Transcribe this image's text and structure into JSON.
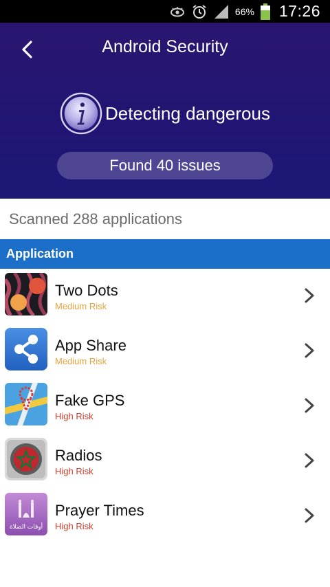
{
  "status_bar": {
    "battery_percent": "66%",
    "time": "17:26",
    "icons": [
      "eye-icon",
      "alarm-icon",
      "signal-icon",
      "battery-icon"
    ]
  },
  "header": {
    "title": "Android Security",
    "detect_text": "Detecting dangerous",
    "found_text": "Found 40 issues"
  },
  "scan": {
    "scanned_text": "Scanned 288 applications"
  },
  "section": {
    "label": "Application"
  },
  "apps": [
    {
      "name": "Two Dots",
      "risk": "Medium Risk",
      "icon": "two-dots-icon"
    },
    {
      "name": "App Share",
      "risk": "Medium Risk",
      "icon": "share-icon"
    },
    {
      "name": "Fake GPS",
      "risk": "High Risk",
      "icon": "map-pin-icon"
    },
    {
      "name": "Radios",
      "risk": "High Risk",
      "icon": "radio-flag-icon"
    },
    {
      "name": "Prayer Times",
      "risk": "High Risk",
      "icon": "mosque-icon",
      "icon_text": "أوقات الصلاة"
    }
  ],
  "colors": {
    "header_bg": "#201573",
    "pill_bg": "#4e4593",
    "section_bg": "#1b6fc9",
    "medium_risk": "#e8a23a",
    "high_risk": "#d23b2e"
  }
}
